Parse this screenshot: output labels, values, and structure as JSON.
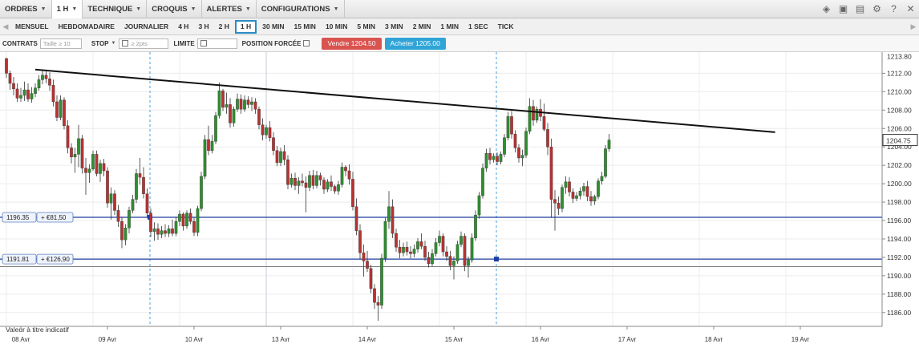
{
  "menubar": {
    "items": [
      {
        "label": "ORDRES",
        "active": false
      },
      {
        "label": "1 H",
        "active": true
      },
      {
        "label": "TECHNIQUE",
        "active": false
      },
      {
        "label": "CROQUIS",
        "active": false
      },
      {
        "label": "ALERTES",
        "active": false
      },
      {
        "label": "CONFIGURATIONS",
        "active": false
      }
    ],
    "right_icons": [
      "layers-icon",
      "image-icon",
      "save-icon",
      "gear-icon",
      "help-icon",
      "close-icon"
    ]
  },
  "periods": {
    "items": [
      "MENSUEL",
      "HEBDOMADAIRE",
      "JOURNALIER",
      "4 H",
      "3 H",
      "2 H",
      "1 H",
      "30 MIN",
      "15 MIN",
      "10 MIN",
      "5 MIN",
      "3 MIN",
      "2 MIN",
      "1 MIN",
      "1 SEC",
      "TICK"
    ],
    "selected": "1 H"
  },
  "order_bar": {
    "contracts_label": "CONTRATS",
    "contracts_placeholder": "Taille ≥ 10",
    "stop_label": "STOP",
    "stop_placeholder": "≥ 2pts",
    "limit_label": "LIMITE",
    "forced_position_label": "POSITION FORCÉE",
    "sell_label": "Vendre 1204.50",
    "buy_label": "Acheter 1205.00"
  },
  "chart_data": {
    "type": "candlestick",
    "ylim": [
      1184.5,
      1214.3
    ],
    "y_ticks": [
      1186,
      1188,
      1190,
      1192,
      1194,
      1196,
      1198,
      1200,
      1202,
      1204,
      1206,
      1208,
      1210,
      1212
    ],
    "y_tick_labels": [
      "1186.00",
      "1188.00",
      "1190.00",
      "1192.00",
      "1194.00",
      "1196.00",
      "1198.00",
      "1200.00",
      "1202.00",
      "1204.00",
      "1206.00",
      "1208.00",
      "1210.00",
      "1212.00",
      "1213.80"
    ],
    "top_label_value": 1213.8,
    "last_price": 1204.75,
    "last_price_label": "1204.75",
    "x_labels": [
      {
        "label": "08 Avr",
        "bar": 0
      },
      {
        "label": "09 Avr",
        "bar": 24
      },
      {
        "label": "10 Avr",
        "bar": 48
      },
      {
        "label": "13 Avr",
        "bar": 72
      },
      {
        "label": "14 Avr",
        "bar": 96
      },
      {
        "label": "15 Avr",
        "bar": 120
      },
      {
        "label": "16 Avr",
        "bar": 144
      },
      {
        "label": "17 Avr",
        "bar": 168
      },
      {
        "label": "18 Avr",
        "bar": 192
      },
      {
        "label": "19 Avr",
        "bar": 216
      }
    ],
    "session_separator_label": "13 Avr",
    "trendline": {
      "from": {
        "bar": 8,
        "price": 1212.4
      },
      "to": {
        "bar": 213,
        "price": 1205.6
      }
    },
    "levels": [
      {
        "price": 1196.35,
        "label": "1196.35",
        "pl": "+ €81,50",
        "color": "#1f3fa0"
      },
      {
        "price": 1191.81,
        "label": "1191.81",
        "pl": "+ €126,90",
        "color": "#1f3fa0"
      }
    ],
    "gray_level": 1191.0,
    "candles": [
      [
        1213.6,
        1213.7,
        1211.5,
        1212.0
      ],
      [
        1212.0,
        1212.3,
        1210.2,
        1210.9
      ],
      [
        1210.9,
        1211.6,
        1209.6,
        1210.3
      ],
      [
        1210.3,
        1210.9,
        1208.9,
        1209.3
      ],
      [
        1209.3,
        1210.4,
        1208.9,
        1209.6
      ],
      [
        1209.6,
        1211.1,
        1209.0,
        1210.2
      ],
      [
        1210.2,
        1210.9,
        1208.9,
        1209.2
      ],
      [
        1209.2,
        1210.5,
        1208.8,
        1209.8
      ],
      [
        1209.8,
        1210.9,
        1209.4,
        1210.4
      ],
      [
        1210.4,
        1211.8,
        1210.1,
        1211.3
      ],
      [
        1211.3,
        1212.4,
        1210.8,
        1211.8
      ],
      [
        1211.8,
        1212.4,
        1210.9,
        1211.4
      ],
      [
        1211.4,
        1212.1,
        1210.1,
        1210.7
      ],
      [
        1210.7,
        1211.3,
        1208.4,
        1208.9
      ],
      [
        1208.9,
        1209.6,
        1206.8,
        1207.2
      ],
      [
        1207.2,
        1209.6,
        1206.9,
        1209.1
      ],
      [
        1209.1,
        1209.4,
        1205.9,
        1206.3
      ],
      [
        1206.3,
        1206.9,
        1203.3,
        1203.9
      ],
      [
        1203.9,
        1204.4,
        1202.2,
        1202.9
      ],
      [
        1202.9,
        1203.9,
        1201.2,
        1203.2
      ],
      [
        1203.2,
        1206.4,
        1201.8,
        1204.9
      ],
      [
        1204.9,
        1205.3,
        1201.1,
        1201.7
      ],
      [
        1201.7,
        1202.8,
        1198.8,
        1201.2
      ],
      [
        1201.2,
        1202.1,
        1200.1,
        1201.6
      ],
      [
        1201.6,
        1203.6,
        1201.4,
        1203.2
      ],
      [
        1203.2,
        1203.6,
        1200.8,
        1201.1
      ],
      [
        1201.1,
        1202.6,
        1200.2,
        1202.2
      ],
      [
        1202.2,
        1202.7,
        1200.8,
        1201.4
      ],
      [
        1201.4,
        1201.8,
        1197.4,
        1197.9
      ],
      [
        1197.9,
        1199.6,
        1196.1,
        1198.9
      ],
      [
        1198.9,
        1199.3,
        1196.6,
        1197.1
      ],
      [
        1197.1,
        1197.7,
        1195.3,
        1195.9
      ],
      [
        1195.9,
        1196.4,
        1193.0,
        1193.9
      ],
      [
        1193.9,
        1195.6,
        1193.3,
        1195.2
      ],
      [
        1195.2,
        1197.5,
        1194.6,
        1197.1
      ],
      [
        1197.1,
        1198.8,
        1196.8,
        1198.3
      ],
      [
        1198.3,
        1201.6,
        1197.9,
        1201.1
      ],
      [
        1201.1,
        1202.8,
        1199.9,
        1200.7
      ],
      [
        1200.7,
        1201.8,
        1198.4,
        1198.9
      ],
      [
        1198.9,
        1199.5,
        1196.3,
        1196.8
      ],
      [
        1196.8,
        1197.3,
        1194.2,
        1194.8
      ],
      [
        1194.8,
        1195.8,
        1193.8,
        1195.1
      ],
      [
        1195.1,
        1195.7,
        1193.9,
        1194.5
      ],
      [
        1194.5,
        1195.4,
        1194.1,
        1194.9
      ],
      [
        1194.9,
        1195.6,
        1194.2,
        1194.6
      ],
      [
        1194.6,
        1195.5,
        1194.2,
        1195.1
      ],
      [
        1195.1,
        1196.1,
        1194.3,
        1194.6
      ],
      [
        1194.6,
        1196.4,
        1194.3,
        1195.9
      ],
      [
        1195.9,
        1197.1,
        1195.4,
        1196.7
      ],
      [
        1196.7,
        1196.9,
        1194.9,
        1195.4
      ],
      [
        1195.4,
        1197.1,
        1195.1,
        1196.8
      ],
      [
        1196.8,
        1197.3,
        1195.6,
        1195.9
      ],
      [
        1195.9,
        1196.3,
        1194.3,
        1194.7
      ],
      [
        1194.7,
        1197.6,
        1194.3,
        1197.3
      ],
      [
        1197.3,
        1201.3,
        1197.0,
        1200.8
      ],
      [
        1200.8,
        1205.3,
        1200.5,
        1204.8
      ],
      [
        1204.8,
        1206.3,
        1203.1,
        1203.6
      ],
      [
        1203.6,
        1205.3,
        1203.3,
        1204.6
      ],
      [
        1204.6,
        1207.8,
        1204.3,
        1207.4
      ],
      [
        1207.4,
        1211.0,
        1207.1,
        1210.1
      ],
      [
        1210.1,
        1210.3,
        1207.9,
        1208.3
      ],
      [
        1208.3,
        1209.9,
        1207.6,
        1208.6
      ],
      [
        1208.6,
        1209.3,
        1206.1,
        1206.6
      ],
      [
        1206.6,
        1208.4,
        1206.2,
        1208.1
      ],
      [
        1208.1,
        1209.8,
        1207.8,
        1209.2
      ],
      [
        1209.2,
        1209.7,
        1207.6,
        1208.1
      ],
      [
        1208.1,
        1209.6,
        1207.8,
        1209.1
      ],
      [
        1209.1,
        1209.5,
        1208.2,
        1208.6
      ],
      [
        1208.6,
        1209.4,
        1207.9,
        1208.9
      ],
      [
        1208.9,
        1209.3,
        1207.6,
        1208.1
      ],
      [
        1208.1,
        1208.4,
        1205.9,
        1206.4
      ],
      [
        1206.4,
        1207.1,
        1204.7,
        1205.3
      ],
      [
        1205.3,
        1206.4,
        1204.9,
        1206.1
      ],
      [
        1206.1,
        1206.8,
        1204.6,
        1205.0
      ],
      [
        1205.0,
        1205.6,
        1203.1,
        1203.6
      ],
      [
        1203.6,
        1204.1,
        1201.9,
        1202.3
      ],
      [
        1202.3,
        1203.9,
        1201.9,
        1203.5
      ],
      [
        1203.5,
        1204.2,
        1202.0,
        1202.6
      ],
      [
        1202.6,
        1203.1,
        1199.4,
        1199.9
      ],
      [
        1199.9,
        1201.1,
        1199.6,
        1200.6
      ],
      [
        1200.6,
        1201.2,
        1199.3,
        1199.8
      ],
      [
        1199.8,
        1200.7,
        1198.9,
        1200.3
      ],
      [
        1200.3,
        1201.1,
        1199.7,
        1200.1
      ],
      [
        1200.1,
        1200.8,
        1196.9,
        1199.6
      ],
      [
        1199.6,
        1201.4,
        1199.2,
        1200.9
      ],
      [
        1200.9,
        1201.5,
        1199.4,
        1199.8
      ],
      [
        1199.8,
        1201.4,
        1199.5,
        1200.9
      ],
      [
        1200.9,
        1201.2,
        1199.8,
        1200.4
      ],
      [
        1200.4,
        1200.7,
        1198.9,
        1199.4
      ],
      [
        1199.4,
        1200.5,
        1199.1,
        1200.2
      ],
      [
        1200.2,
        1200.9,
        1199.2,
        1199.7
      ],
      [
        1199.7,
        1199.9,
        1198.9,
        1199.2
      ],
      [
        1199.2,
        1200.3,
        1198.8,
        1199.9
      ],
      [
        1199.9,
        1202.3,
        1199.6,
        1201.8
      ],
      [
        1201.8,
        1202.0,
        1200.8,
        1201.4
      ],
      [
        1201.4,
        1202.1,
        1199.9,
        1200.5
      ],
      [
        1200.5,
        1201.3,
        1197.1,
        1197.5
      ],
      [
        1197.5,
        1198.4,
        1194.4,
        1194.9
      ],
      [
        1194.9,
        1195.6,
        1191.8,
        1192.5
      ],
      [
        1192.5,
        1193.4,
        1189.9,
        1191.6
      ],
      [
        1191.6,
        1192.7,
        1190.4,
        1190.8
      ],
      [
        1190.8,
        1191.2,
        1188.1,
        1188.6
      ],
      [
        1188.6,
        1189.1,
        1186.4,
        1187.1
      ],
      [
        1187.1,
        1187.8,
        1185.1,
        1186.8
      ],
      [
        1186.8,
        1192.4,
        1186.4,
        1191.9
      ],
      [
        1191.9,
        1196.3,
        1191.5,
        1195.9
      ],
      [
        1195.9,
        1199.2,
        1195.1,
        1197.5
      ],
      [
        1197.5,
        1198.3,
        1194.1,
        1194.6
      ],
      [
        1194.6,
        1195.1,
        1192.6,
        1193.1
      ],
      [
        1193.1,
        1193.9,
        1191.9,
        1192.5
      ],
      [
        1192.5,
        1193.6,
        1192.1,
        1193.1
      ],
      [
        1193.1,
        1193.7,
        1192.2,
        1192.6
      ],
      [
        1192.6,
        1193.2,
        1191.9,
        1192.4
      ],
      [
        1192.4,
        1193.4,
        1192.0,
        1192.9
      ],
      [
        1192.9,
        1194.1,
        1192.5,
        1193.7
      ],
      [
        1193.7,
        1194.6,
        1192.9,
        1193.2
      ],
      [
        1193.2,
        1193.8,
        1191.6,
        1192.0
      ],
      [
        1192.0,
        1192.6,
        1190.9,
        1191.3
      ],
      [
        1191.3,
        1192.9,
        1191.0,
        1192.4
      ],
      [
        1192.4,
        1194.1,
        1192.1,
        1193.6
      ],
      [
        1193.6,
        1194.9,
        1193.2,
        1194.3
      ],
      [
        1194.3,
        1194.6,
        1192.1,
        1192.6
      ],
      [
        1192.6,
        1193.2,
        1191.6,
        1192.1
      ],
      [
        1192.1,
        1192.7,
        1190.6,
        1191.1
      ],
      [
        1191.1,
        1192.1,
        1189.6,
        1191.6
      ],
      [
        1191.6,
        1193.8,
        1191.3,
        1193.4
      ],
      [
        1193.4,
        1194.8,
        1193.1,
        1194.3
      ],
      [
        1194.3,
        1194.6,
        1190.5,
        1191.1
      ],
      [
        1191.1,
        1192.1,
        1189.8,
        1191.7
      ],
      [
        1191.7,
        1194.6,
        1191.4,
        1194.1
      ],
      [
        1194.1,
        1197.1,
        1193.8,
        1196.6
      ],
      [
        1196.6,
        1199.1,
        1196.2,
        1198.7
      ],
      [
        1198.7,
        1202.2,
        1198.4,
        1201.7
      ],
      [
        1201.7,
        1203.8,
        1201.3,
        1203.3
      ],
      [
        1203.3,
        1203.9,
        1202.1,
        1202.6
      ],
      [
        1202.6,
        1203.3,
        1202.3,
        1203.0
      ],
      [
        1203.0,
        1203.4,
        1202.0,
        1202.4
      ],
      [
        1202.4,
        1203.5,
        1202.1,
        1203.2
      ],
      [
        1203.2,
        1205.4,
        1202.9,
        1205.0
      ],
      [
        1205.0,
        1207.8,
        1204.7,
        1207.3
      ],
      [
        1207.3,
        1207.9,
        1204.9,
        1205.4
      ],
      [
        1205.4,
        1205.8,
        1203.4,
        1203.9
      ],
      [
        1203.9,
        1204.3,
        1202.3,
        1202.8
      ],
      [
        1202.8,
        1203.7,
        1201.9,
        1203.1
      ],
      [
        1203.1,
        1206.1,
        1202.8,
        1205.7
      ],
      [
        1205.7,
        1209.3,
        1205.4,
        1208.4
      ],
      [
        1208.4,
        1209.1,
        1206.3,
        1206.9
      ],
      [
        1206.9,
        1208.4,
        1206.6,
        1208.1
      ],
      [
        1208.1,
        1209.2,
        1206.8,
        1207.3
      ],
      [
        1207.3,
        1208.7,
        1205.7,
        1205.9
      ],
      [
        1205.9,
        1206.6,
        1203.1,
        1204.0
      ],
      [
        1204.0,
        1204.9,
        1196.3,
        1198.3
      ],
      [
        1198.3,
        1199.3,
        1194.9,
        1197.9
      ],
      [
        1197.9,
        1198.6,
        1196.6,
        1197.3
      ],
      [
        1197.3,
        1199.9,
        1196.9,
        1199.6
      ],
      [
        1199.6,
        1200.8,
        1198.9,
        1200.2
      ],
      [
        1200.2,
        1200.7,
        1198.6,
        1199.1
      ],
      [
        1199.1,
        1199.5,
        1197.9,
        1198.4
      ],
      [
        1198.4,
        1199.1,
        1198.1,
        1198.7
      ],
      [
        1198.7,
        1199.6,
        1198.3,
        1199.2
      ],
      [
        1199.2,
        1200.1,
        1198.7,
        1199.7
      ],
      [
        1199.7,
        1200.3,
        1198.1,
        1198.6
      ],
      [
        1198.6,
        1199.2,
        1197.6,
        1198.1
      ],
      [
        1198.1,
        1198.8,
        1197.7,
        1198.6
      ],
      [
        1198.6,
        1200.6,
        1198.3,
        1200.3
      ],
      [
        1200.3,
        1201.3,
        1199.9,
        1200.8
      ],
      [
        1200.8,
        1204.2,
        1200.6,
        1203.8
      ],
      [
        1203.8,
        1205.4,
        1203.5,
        1204.75
      ]
    ]
  },
  "footer": {
    "disclaimer": "Valeur à titre indicatif"
  }
}
